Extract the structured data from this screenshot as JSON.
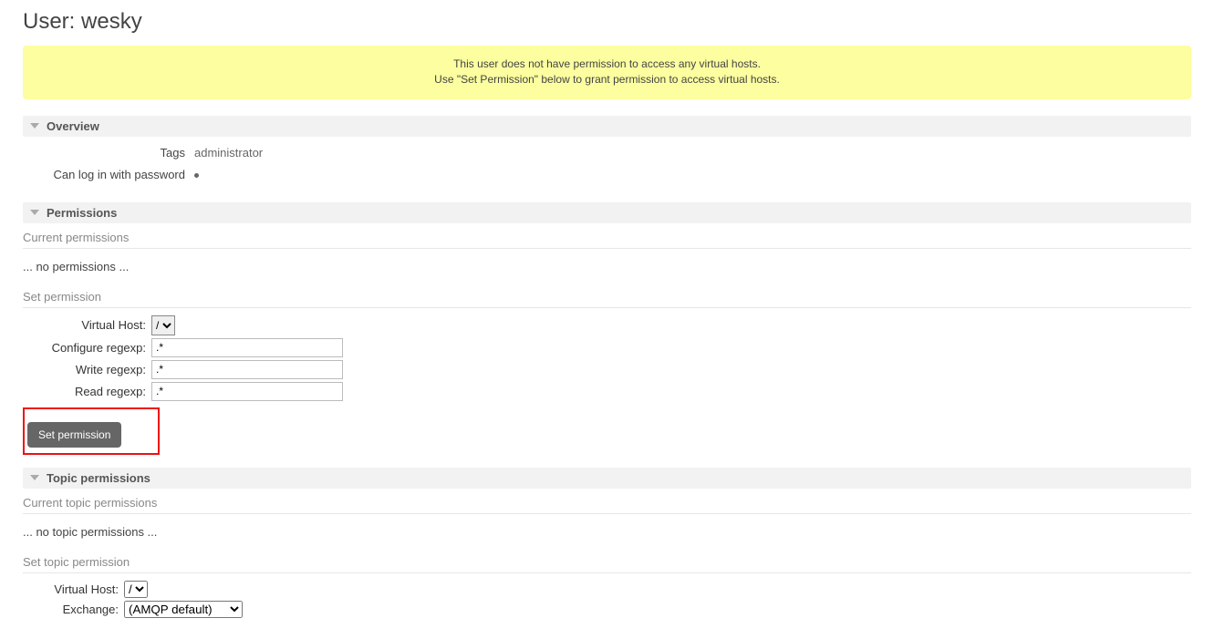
{
  "header": {
    "title_prefix": "User:",
    "username": "wesky"
  },
  "alert": {
    "line1": "This user does not have permission to access any virtual hosts.",
    "line2": "Use \"Set Permission\" below to grant permission to access virtual hosts."
  },
  "overview": {
    "section_title": "Overview",
    "tags_label": "Tags",
    "tags_value": "administrator",
    "login_label": "Can log in with password",
    "login_bullet": true
  },
  "permissions": {
    "section_title": "Permissions",
    "current_heading": "Current permissions",
    "current_empty": "... no permissions ...",
    "set_heading": "Set permission",
    "fields": {
      "vhost_label": "Virtual Host:",
      "vhost_value": "/",
      "configure_label": "Configure regexp:",
      "configure_value": ".*",
      "write_label": "Write regexp:",
      "write_value": ".*",
      "read_label": "Read regexp:",
      "read_value": ".*"
    },
    "submit_label": "Set permission"
  },
  "topic_permissions": {
    "section_title": "Topic permissions",
    "current_heading": "Current topic permissions",
    "current_empty": "... no topic permissions ...",
    "set_heading": "Set topic permission",
    "fields": {
      "vhost_label": "Virtual Host:",
      "vhost_value": "/",
      "exchange_label": "Exchange:",
      "exchange_value": "(AMQP default)"
    }
  }
}
